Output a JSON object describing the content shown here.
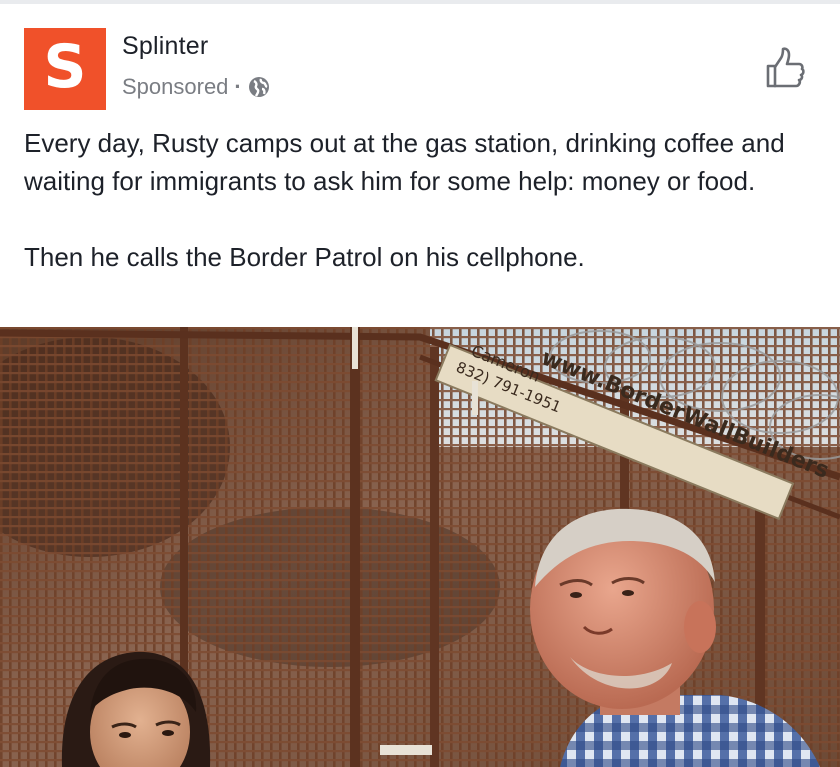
{
  "post": {
    "page_name": "Splinter",
    "avatar_letter": "S",
    "sponsored_label": "Sponsored",
    "separator": "·",
    "body_paragraphs": [
      "Every day, Rusty camps out at the gas station, drinking coffee and waiting for immigrants to ask him for some help: money or food.",
      "Then he calls the Border Patrol on his cellphone."
    ]
  },
  "photo": {
    "sign_line_1": "www.BorderWallBuilders",
    "sign_line_2": "Cameron",
    "sign_line_3": "832) 791-1951"
  },
  "icons": {
    "privacy": "globe-icon",
    "reaction": "thumbs-up-icon"
  },
  "colors": {
    "brand": "#f0512a",
    "text": "#1d2129",
    "secondary_text": "#7a7d83",
    "fence": "#7a4b33"
  }
}
